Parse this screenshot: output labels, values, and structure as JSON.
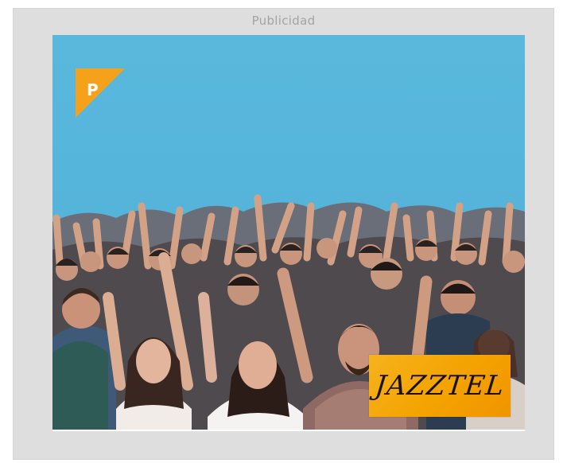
{
  "ad": {
    "label": "Publicidad",
    "corner_badge_letter": "P",
    "brand_logo_text": "JAZZTEL",
    "colors": {
      "frame": "#dedede",
      "sky": "#58b9dc",
      "brand_orange": "#f4a300",
      "label_text": "#a3a3a3"
    }
  }
}
